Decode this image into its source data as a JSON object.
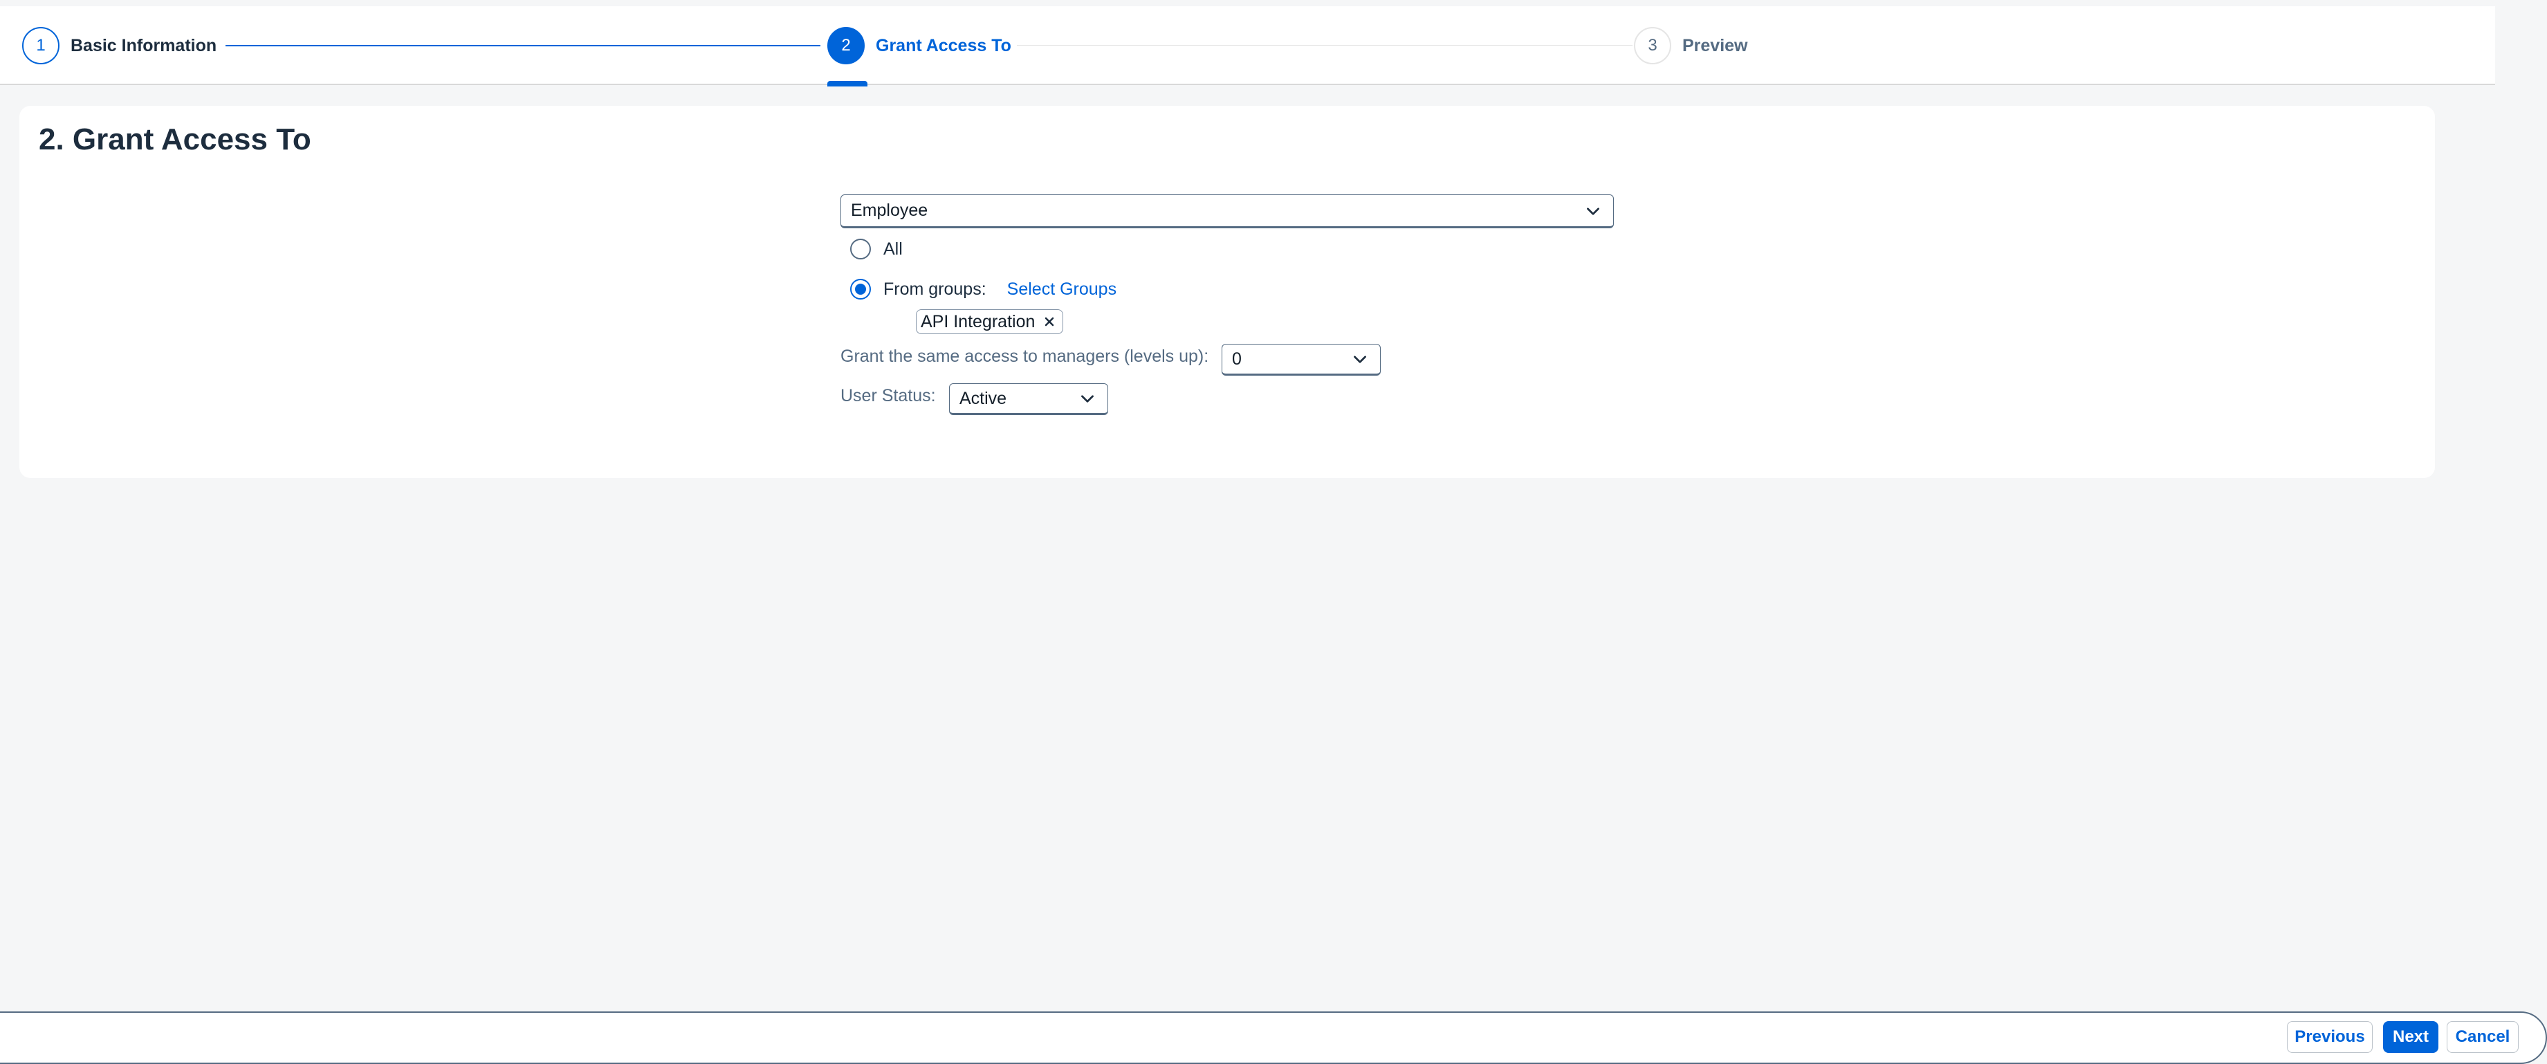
{
  "wizard": {
    "steps": [
      {
        "number": "1",
        "label": "Basic Information",
        "state": "completed"
      },
      {
        "number": "2",
        "label": "Grant Access To",
        "state": "active"
      },
      {
        "number": "3",
        "label": "Preview",
        "state": "upcoming"
      }
    ]
  },
  "main": {
    "title": "2. Grant Access To",
    "target_type": {
      "value": "Employee",
      "icon": "chevron-down-icon"
    },
    "scope": {
      "all_label": "All",
      "groups_label": "From groups:",
      "select_groups_link": "Select Groups",
      "selected": "groups",
      "tokens": [
        {
          "label": "API Integration",
          "icon": "close-icon"
        }
      ]
    },
    "managers": {
      "label": "Grant the same access to managers (levels up):",
      "value": "0"
    },
    "user_status": {
      "label": "User Status:",
      "value": "Active"
    }
  },
  "footer": {
    "previous_label": "Previous",
    "next_label": "Next",
    "cancel_label": "Cancel"
  },
  "colors": {
    "accent": "#0064d9",
    "background": "#f5f6f7",
    "text": "#1d2d3e",
    "muted_text": "#556b82"
  }
}
